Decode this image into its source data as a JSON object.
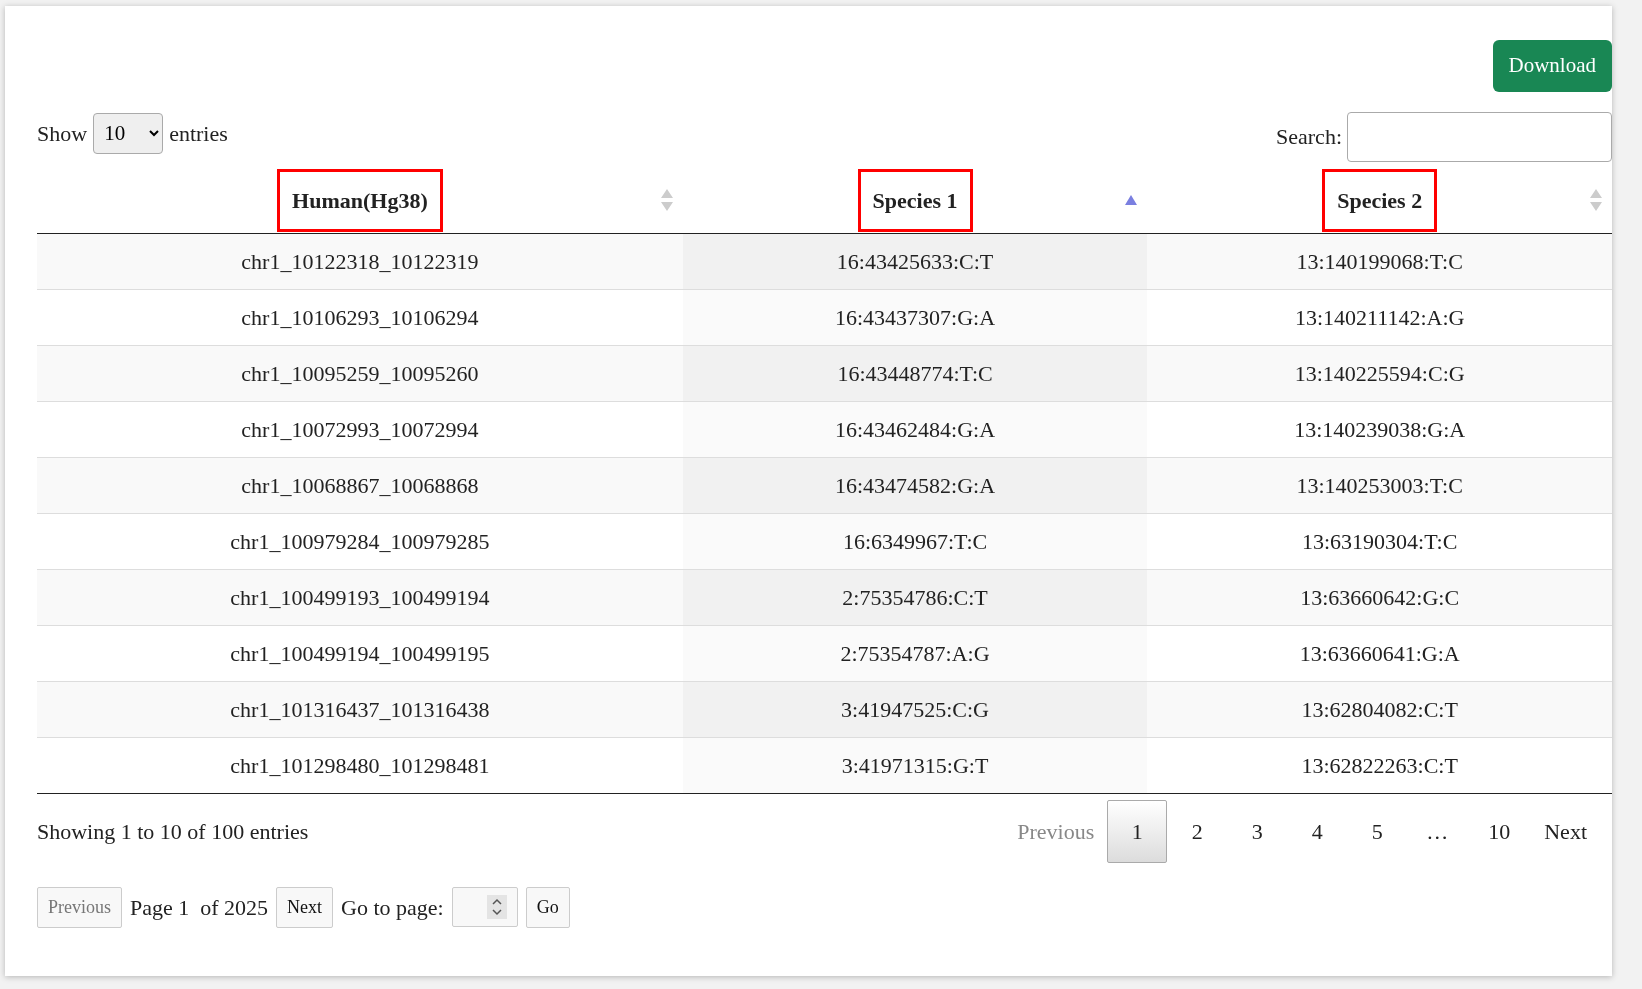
{
  "download_button": "Download",
  "length_control": {
    "label_before": "Show",
    "value": "10",
    "label_after": "entries"
  },
  "search": {
    "label": "Search:"
  },
  "table": {
    "columns": [
      {
        "label": "Human(Hg38)",
        "sorted": false,
        "highlighted": true
      },
      {
        "label": "Species 1",
        "sorted": true,
        "highlighted": true
      },
      {
        "label": "Species 2",
        "sorted": false,
        "highlighted": true
      }
    ],
    "rows": [
      [
        "chr1_10122318_10122319",
        "16:43425633:C:T",
        "13:140199068:T:C"
      ],
      [
        "chr1_10106293_10106294",
        "16:43437307:G:A",
        "13:140211142:A:G"
      ],
      [
        "chr1_10095259_10095260",
        "16:43448774:T:C",
        "13:140225594:C:G"
      ],
      [
        "chr1_10072993_10072994",
        "16:43462484:G:A",
        "13:140239038:G:A"
      ],
      [
        "chr1_10068867_10068868",
        "16:43474582:G:A",
        "13:140253003:T:C"
      ],
      [
        "chr1_100979284_100979285",
        "16:6349967:T:C",
        "13:63190304:T:C"
      ],
      [
        "chr1_100499193_100499194",
        "2:75354786:C:T",
        "13:63660642:G:C"
      ],
      [
        "chr1_100499194_100499195",
        "2:75354787:A:G",
        "13:63660641:G:A"
      ],
      [
        "chr1_101316437_101316438",
        "3:41947525:C:G",
        "13:62804082:C:T"
      ],
      [
        "chr1_101298480_101298481",
        "3:41971315:G:T",
        "13:62822263:C:T"
      ]
    ]
  },
  "info": "Showing 1 to 10 of 100 entries",
  "pagination": [
    {
      "label": "Previous",
      "kind": "nav",
      "disabled": true,
      "selected": false
    },
    {
      "label": "1",
      "kind": "page",
      "disabled": false,
      "selected": true
    },
    {
      "label": "2",
      "kind": "page",
      "disabled": false,
      "selected": false
    },
    {
      "label": "3",
      "kind": "page",
      "disabled": false,
      "selected": false
    },
    {
      "label": "4",
      "kind": "page",
      "disabled": false,
      "selected": false
    },
    {
      "label": "5",
      "kind": "page",
      "disabled": false,
      "selected": false
    },
    {
      "label": "…",
      "kind": "ellipsis"
    },
    {
      "label": "10",
      "kind": "page",
      "disabled": false,
      "selected": false
    },
    {
      "label": "Next",
      "kind": "nav",
      "disabled": false,
      "selected": false
    }
  ],
  "pager": {
    "previous": {
      "label": "Previous",
      "disabled": true
    },
    "page_text": "Page 1  of 2025",
    "next": {
      "label": "Next",
      "disabled": false
    },
    "goto_label": "Go to page:",
    "go_button": "Go"
  }
}
